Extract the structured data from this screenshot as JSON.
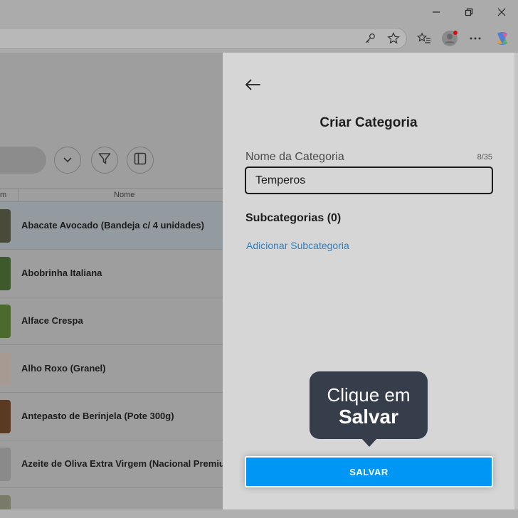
{
  "browser": {
    "icons": [
      "minimize-icon",
      "restore-icon",
      "close-icon",
      "key-icon",
      "star-icon",
      "favorites-icon",
      "profile-icon",
      "more-icon",
      "copilot-icon"
    ]
  },
  "app": {
    "table": {
      "columns": [
        "m",
        "Nome"
      ],
      "rows": [
        {
          "name": "Abacate Avocado (Bandeja c/ 4 unidades)",
          "thumb_color": "#4a4a3a",
          "selected": true
        },
        {
          "name": "Abobrinha Italiana",
          "thumb_color": "#3e5a2c"
        },
        {
          "name": "Alface Crespa",
          "thumb_color": "#4c6a2e"
        },
        {
          "name": "Alho Roxo (Granel)",
          "thumb_color": "#a69a92"
        },
        {
          "name": "Antepasto de Berinjela (Pote 300g)",
          "thumb_color": "#5a3a22"
        },
        {
          "name": "Azeite de Oliva Extra Virgem (Nacional Premium)",
          "thumb_color": "#8a8a8a"
        }
      ]
    }
  },
  "panel": {
    "title": "Criar Categoria",
    "field_label": "Nome da Categoria",
    "counter": "8/35",
    "name_value": "Temperos",
    "subcategories_title": "Subcategorias (0)",
    "add_subcategory": "Adicionar Subcategoria",
    "save_label": "SALVAR"
  },
  "tooltip": {
    "line1": "Clique em",
    "line2": "Salvar"
  },
  "colors": {
    "accent": "#0096f5",
    "link": "#2d7fc1",
    "tooltip_bg": "#363d4b"
  }
}
